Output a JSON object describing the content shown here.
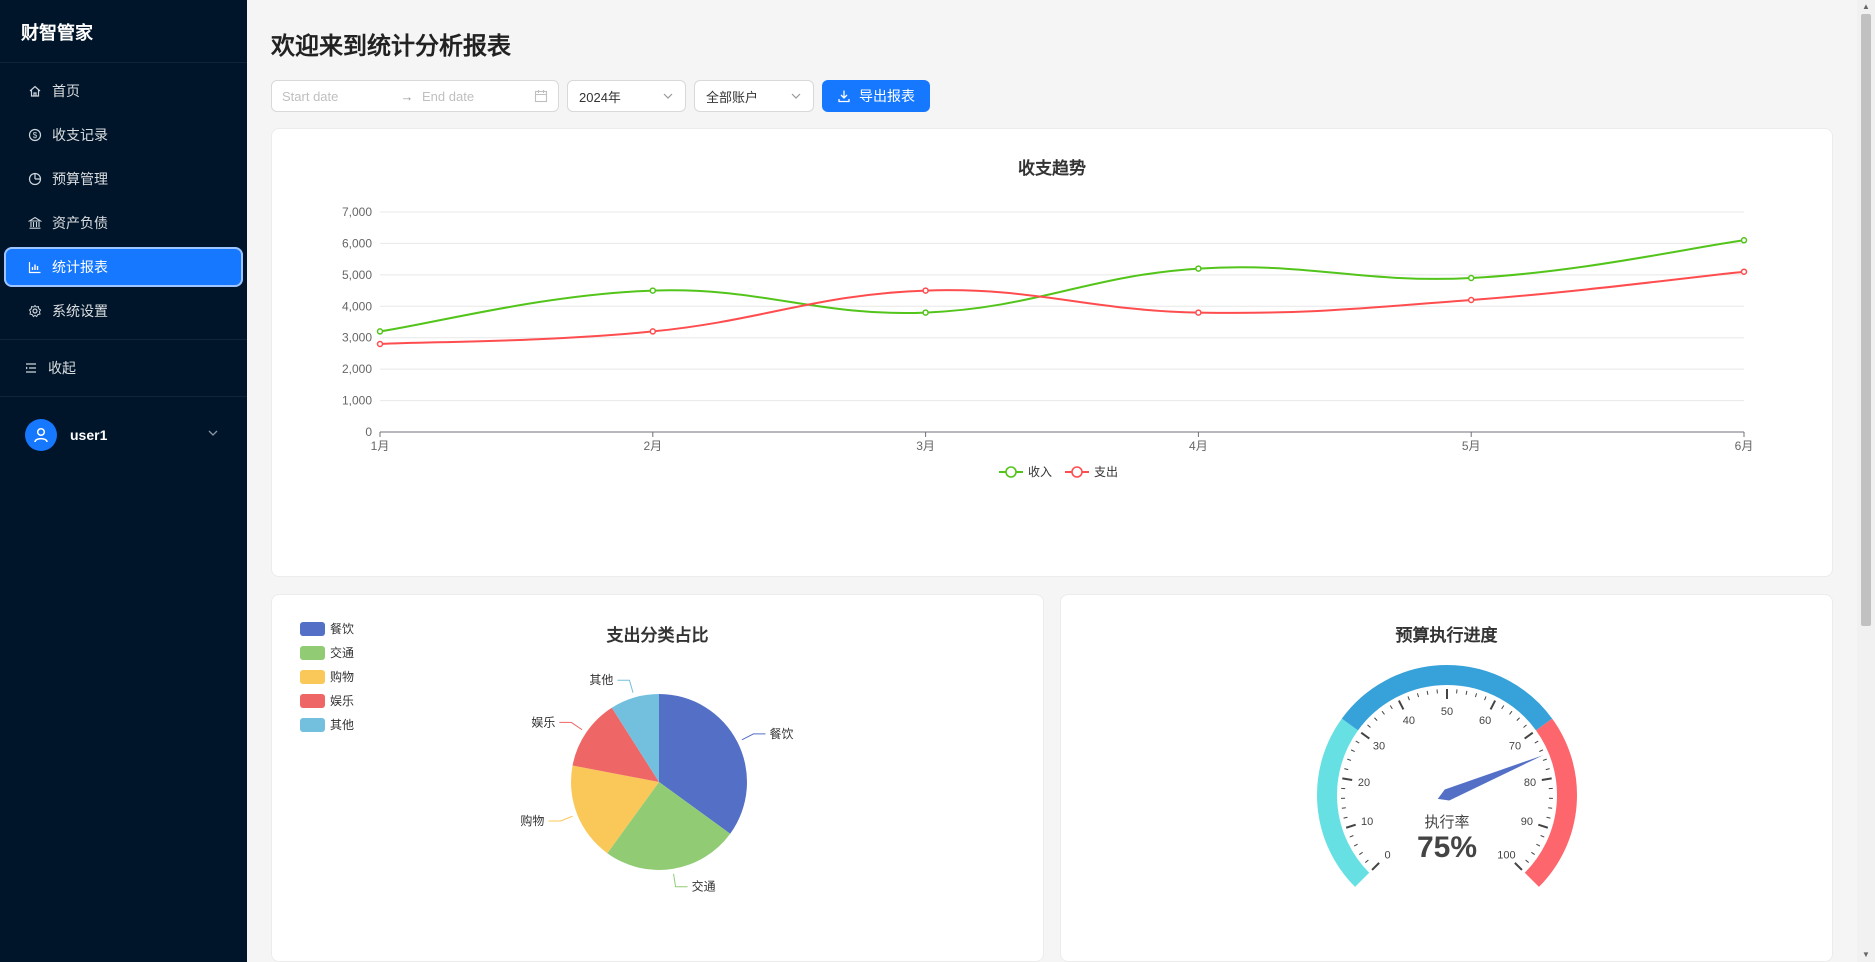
{
  "app": {
    "brand": "财智管家"
  },
  "sidebar": {
    "items": [
      {
        "label": "首页",
        "icon": "home-icon"
      },
      {
        "label": "收支记录",
        "icon": "dollar-icon"
      },
      {
        "label": "预算管理",
        "icon": "pie-icon"
      },
      {
        "label": "资产负债",
        "icon": "bank-icon"
      },
      {
        "label": "统计报表",
        "icon": "bar-chart-icon",
        "active": true
      },
      {
        "label": "系统设置",
        "icon": "gear-icon"
      }
    ],
    "collapse_label": "收起",
    "user": {
      "name": "user1"
    }
  },
  "header": {
    "title": "欢迎来到统计分析报表"
  },
  "toolbar": {
    "start_placeholder": "Start date",
    "end_placeholder": "End date",
    "year_value": "2024年",
    "account_value": "全部账户",
    "export_label": "导出报表"
  },
  "colors": {
    "sidebar_bg": "#001529",
    "accent": "#1677ff",
    "income": "#52c41a",
    "expense": "#ff4d4f"
  },
  "chart_data": [
    {
      "type": "line",
      "title": "收支趋势",
      "categories": [
        "1月",
        "2月",
        "3月",
        "4月",
        "5月",
        "6月"
      ],
      "series": [
        {
          "name": "收入",
          "values": [
            3200,
            4500,
            3800,
            5200,
            4900,
            6100
          ],
          "color": "#52c41a"
        },
        {
          "name": "支出",
          "values": [
            2800,
            3200,
            4500,
            3800,
            4200,
            5100
          ],
          "color": "#ff4d4f"
        }
      ],
      "ylim": [
        0,
        7000
      ],
      "yticks": [
        "0",
        "1,000",
        "2,000",
        "3,000",
        "4,000",
        "5,000",
        "6,000",
        "7,000"
      ],
      "smooth": true,
      "grid": true,
      "legend": "bottom-center"
    },
    {
      "type": "pie",
      "title": "支出分类占比",
      "slices": [
        {
          "name": "餐饮",
          "value": 35,
          "color": "#5470c6"
        },
        {
          "name": "交通",
          "value": 25,
          "color": "#91cc75"
        },
        {
          "name": "购物",
          "value": 18,
          "color": "#fac858"
        },
        {
          "name": "娱乐",
          "value": 13,
          "color": "#ee6666"
        },
        {
          "name": "其他",
          "value": 9,
          "color": "#73c0de"
        }
      ],
      "legend": "top-left"
    },
    {
      "type": "gauge",
      "title": "预算执行进度",
      "min": 0,
      "max": 100,
      "value": 75,
      "label": "执行率",
      "value_text": "75%",
      "ticks": [
        "0",
        "10",
        "20",
        "30",
        "40",
        "50",
        "60",
        "70",
        "80",
        "90",
        "100"
      ],
      "bands": [
        {
          "to": 0.3,
          "color": "#67e0e3"
        },
        {
          "to": 0.7,
          "color": "#37a2da"
        },
        {
          "to": 1.0,
          "color": "#fd666d"
        }
      ]
    }
  ]
}
